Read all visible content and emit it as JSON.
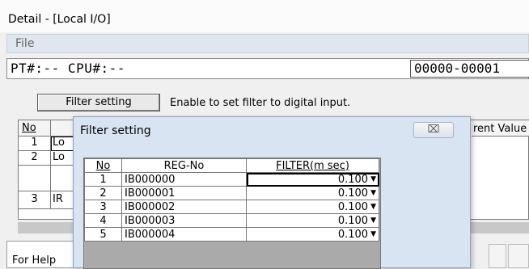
{
  "window": {
    "title": "Detail - [Local I/O]"
  },
  "menu": {
    "file": "File"
  },
  "ptbar": {
    "label": "PT#:-- CPU#:--",
    "range_value": "00000-00001"
  },
  "toolbar": {
    "filter_button": "Filter setting",
    "hint": "Enable to set filter to digital input."
  },
  "background_table": {
    "col_no": "No",
    "col_current_value": "rent Value",
    "rows": [
      {
        "no": "1",
        "name": "Lo"
      },
      {
        "no": "2",
        "name": "Lo"
      },
      {
        "no": "",
        "name": ""
      },
      {
        "no": "3",
        "name": "IR"
      }
    ]
  },
  "help": {
    "label": "For Help"
  },
  "dialog": {
    "title": "Filter setting",
    "close_glyph": "⌧",
    "columns": {
      "no": "No",
      "reg_no": "REG-No",
      "filter": "FILTER(m sec)"
    },
    "rows": [
      {
        "no": "1",
        "reg": "IB000000",
        "filter": "0.100"
      },
      {
        "no": "2",
        "reg": "IB000001",
        "filter": "0.100"
      },
      {
        "no": "3",
        "reg": "IB000002",
        "filter": "0.100"
      },
      {
        "no": "4",
        "reg": "IB000003",
        "filter": "0.100"
      },
      {
        "no": "5",
        "reg": "IB000004",
        "filter": "0.100"
      }
    ]
  },
  "colors": {
    "dialog_bg": "#d8e4f2",
    "menubar_bg": "#dfe6f0",
    "grid_gray": "#aaaaaa"
  }
}
